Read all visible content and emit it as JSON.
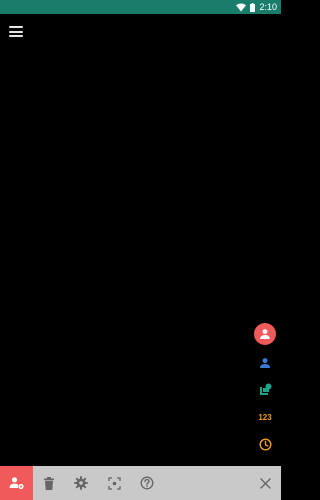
{
  "status_bar": {
    "time": "2:10",
    "background": "#1a7d6c",
    "icons": [
      "wifi-icon",
      "battery-icon"
    ]
  },
  "header": {
    "menu_icon": "hamburger-menu-icon"
  },
  "side_actions": {
    "main": {
      "icon": "person-icon",
      "color": "#f05a5a"
    },
    "person": {
      "icon": "person-icon",
      "color": "#3a7bd5"
    },
    "layers": {
      "icon": "layers-icon",
      "color": "#1aa58c"
    },
    "numbers": {
      "label": "123",
      "color": "#f0a020"
    },
    "clock": {
      "icon": "clock-icon",
      "color": "#f0a020"
    }
  },
  "bottom_toolbar": {
    "background": "#c9c9c9",
    "active_color": "#f05a5a",
    "items": [
      {
        "name": "person-settings",
        "icon": "person-settings-icon"
      },
      {
        "name": "delete",
        "icon": "trash-icon"
      },
      {
        "name": "settings",
        "icon": "gear-icon"
      },
      {
        "name": "capture",
        "icon": "focus-frame-icon"
      },
      {
        "name": "help",
        "icon": "help-icon"
      },
      {
        "name": "close",
        "icon": "close-icon"
      }
    ]
  }
}
